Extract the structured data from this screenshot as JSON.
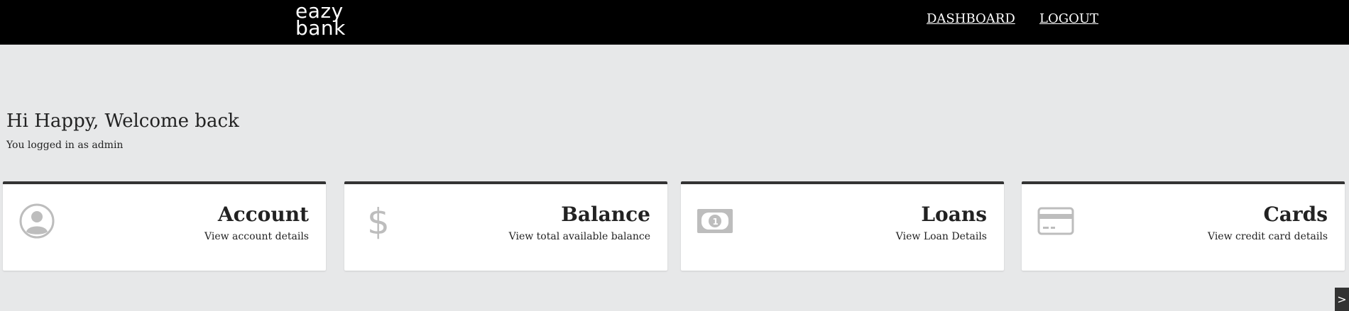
{
  "header": {
    "logo_line1": "eazy",
    "logo_line2": "bank",
    "nav": {
      "dashboard": "DASHBOARD",
      "logout": "LOGOUT"
    }
  },
  "welcome": {
    "greeting": "Hi Happy, Welcome back",
    "subtext": "You logged in as admin"
  },
  "cards": [
    {
      "title": "Account",
      "description": "View account details",
      "icon": "user-circle-icon"
    },
    {
      "title": "Balance",
      "description": "View total available balance",
      "icon": "dollar-icon"
    },
    {
      "title": "Loans",
      "description": "View Loan Details",
      "icon": "banknote-icon"
    },
    {
      "title": "Cards",
      "description": "View credit card details",
      "icon": "credit-card-icon"
    }
  ],
  "corner_button": {
    "label": ">"
  },
  "colors": {
    "header_bg": "#000000",
    "page_bg": "#e7e8e9",
    "card_bg": "#ffffff",
    "card_border": "#333333",
    "icon_gray": "#bdbdbd"
  }
}
